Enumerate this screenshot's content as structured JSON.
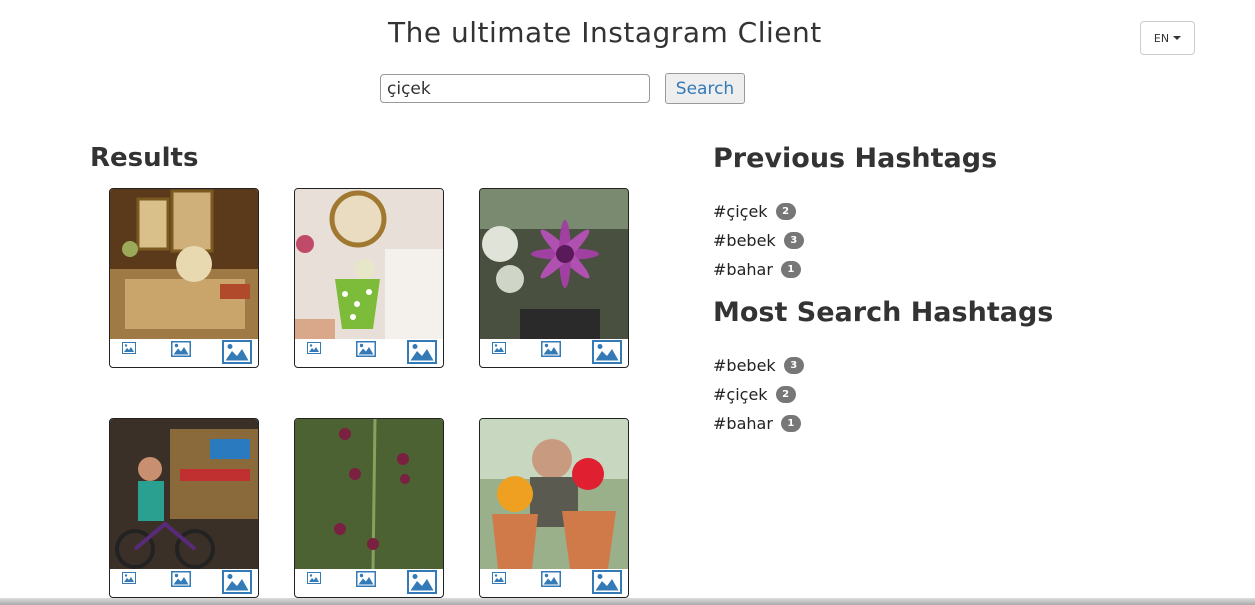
{
  "header": {
    "title": "The ultimate Instagram Client",
    "language": "EN"
  },
  "search": {
    "value": "çiçek",
    "button_label": "Search"
  },
  "results": {
    "heading": "Results",
    "items": [
      {
        "scene": "living room with mirrors and lamp"
      },
      {
        "scene": "green polka-dot cup with flowers"
      },
      {
        "scene": "purple flower bouquet"
      },
      {
        "scene": "man on bicycle in workshop"
      },
      {
        "scene": "pink flowers on stem"
      },
      {
        "scene": "man with potted flowers"
      }
    ]
  },
  "previous_hashtags": {
    "heading": "Previous Hashtags",
    "items": [
      {
        "tag": "#çiçek",
        "count": "2"
      },
      {
        "tag": "#bebek",
        "count": "3"
      },
      {
        "tag": "#bahar",
        "count": "1"
      }
    ]
  },
  "most_search_hashtags": {
    "heading": "Most Search Hashtags",
    "items": [
      {
        "tag": "#bebek",
        "count": "3"
      },
      {
        "tag": "#çiçek",
        "count": "2"
      },
      {
        "tag": "#bahar",
        "count": "1"
      }
    ]
  },
  "icons": {
    "thumbnail": "image-icon",
    "color": "#337ab7"
  }
}
